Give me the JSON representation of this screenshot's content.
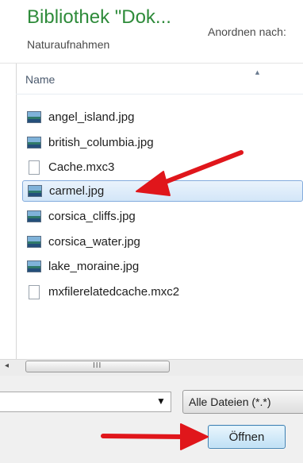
{
  "header": {
    "title": "Bibliothek \"Dok...",
    "subtitle": "Naturaufnahmen",
    "arrange_label": "Anordnen nach:"
  },
  "file_list": {
    "column_name": "Name",
    "files": [
      {
        "name": "angel_island.jpg",
        "icon": "image-file-icon"
      },
      {
        "name": "british_columbia.jpg",
        "icon": "image-file-icon"
      },
      {
        "name": "Cache.mxc3",
        "icon": "blank-file-icon"
      },
      {
        "name": "carmel.jpg",
        "icon": "image-file-icon",
        "selected": true
      },
      {
        "name": "corsica_cliffs.jpg",
        "icon": "image-file-icon"
      },
      {
        "name": "corsica_water.jpg",
        "icon": "image-file-icon"
      },
      {
        "name": "lake_moraine.jpg",
        "icon": "image-file-icon"
      },
      {
        "name": "mxfilerelatedcache.mxc2",
        "icon": "blank-file-icon"
      }
    ]
  },
  "scrollbar": {
    "left_arrow": "◂",
    "grip": "III"
  },
  "footer": {
    "filename_value": "",
    "dropdown_caret": "▼",
    "file_type_filter": "Alle Dateien (*.*)",
    "open_button_label": "Öffnen"
  },
  "colors": {
    "title_green": "#2e8b3a",
    "annotation_red": "#e0161b",
    "selection_border": "#84acdd"
  }
}
